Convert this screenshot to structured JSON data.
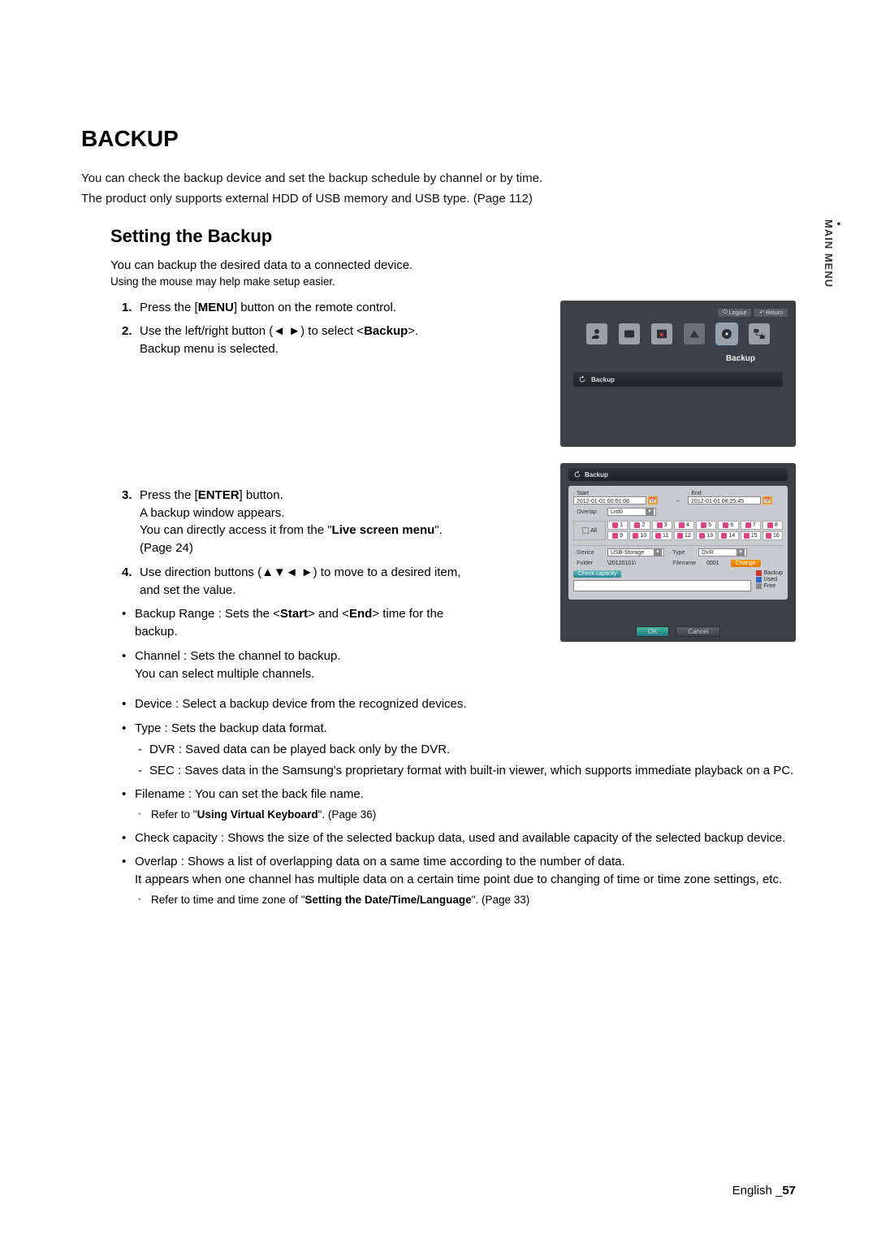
{
  "side_tab": "MAIN MENU",
  "h1": "BACKUP",
  "intro1": "You can check the backup device and set the backup schedule by channel or by time.",
  "intro2": "The product only supports external HDD of USB memory and USB type. (Page 112)",
  "h2": "Setting the Backup",
  "desc": "You can backup the desired data to a connected device.",
  "hint": "Using the mouse may help make setup easier.",
  "step1_a": "Press the [",
  "step1_b": "MENU",
  "step1_c": "] button on the remote control.",
  "step2_a": "Use the left/right button (◄ ►) to select <",
  "step2_b": "Backup",
  "step2_c": ">.",
  "step2_sub": "Backup menu is selected.",
  "step3_a": "Press the [",
  "step3_b": "ENTER",
  "step3_c": "] button.",
  "step3_sub1": "A backup window appears.",
  "step3_sub2a": "You can directly access it from the \"",
  "step3_sub2b": "Live screen menu",
  "step3_sub2c": "\". (Page 24)",
  "step4_a": "Use direction buttons (▲▼◄ ►) to move to a desired item, and set the value.",
  "b_range_a": "Backup Range : Sets the <",
  "b_range_b": "Start",
  "b_range_c": "> and <",
  "b_range_d": "End",
  "b_range_e": "> time for the backup.",
  "b_channel": "Channel : Sets the channel to backup.",
  "b_channel_sub": "You can select multiple channels.",
  "b_device": "Device : Select a backup device from the recognized devices.",
  "b_type": "Type : Sets the backup data format.",
  "b_type_dvr": "DVR : Saved data can be played back only by the DVR.",
  "b_type_sec": "SEC : Saves data in the Samsung's proprietary format with built-in viewer, which supports immediate playback on a PC.",
  "b_filename": "Filename : You can set the back file name.",
  "b_filename_note_a": "Refer to \"",
  "b_filename_note_b": "Using Virtual Keyboard",
  "b_filename_note_c": "\". (Page 36)",
  "b_capacity": "Check capacity : Shows the size of the selected backup data, used and available capacity of the selected backup device.",
  "b_overlap": "Overlap : Shows a list of overlapping data on a same time according to the number of data.",
  "b_overlap_sub": "It appears when one channel has multiple data on a certain time point due to changing of time or time zone settings, etc.",
  "b_overlap_note_a": "Refer to time and time zone of \"",
  "b_overlap_note_b": "Setting the Date/Time/Language",
  "b_overlap_note_c": "\". (Page 33)",
  "footer": {
    "lang": "English",
    "sep": "_",
    "page": "57"
  },
  "shot1": {
    "logout": "Logout",
    "return": "Return",
    "label": "Backup",
    "menu": "Backup"
  },
  "shot2": {
    "title": "Backup",
    "start_lbl": "· Start",
    "start_val": "2012-01-01 00:01:06",
    "end_lbl": "· End",
    "end_val": "2012-01-01 08:25:45",
    "overlap_lbl": "· Overlap",
    "overlap_val": "List0",
    "all": "All",
    "ch": [
      "1",
      "2",
      "3",
      "4",
      "5",
      "6",
      "7",
      "8",
      "9",
      "10",
      "11",
      "12",
      "13",
      "14",
      "15",
      "16"
    ],
    "device_lbl": "· Device",
    "device_val": "USB-Storage",
    "folder_lbl": "· Folder",
    "folder_val": "\\20120101\\",
    "type_lbl": "· Type",
    "type_val": "DVR",
    "filename_lbl": "· Filename",
    "filename_val": "0001",
    "change": "Change",
    "check_cap": "Check capacity",
    "legend": {
      "backup": "Backup",
      "used": "Used",
      "free": "Free"
    },
    "ok": "OK",
    "cancel": "Cancel"
  }
}
